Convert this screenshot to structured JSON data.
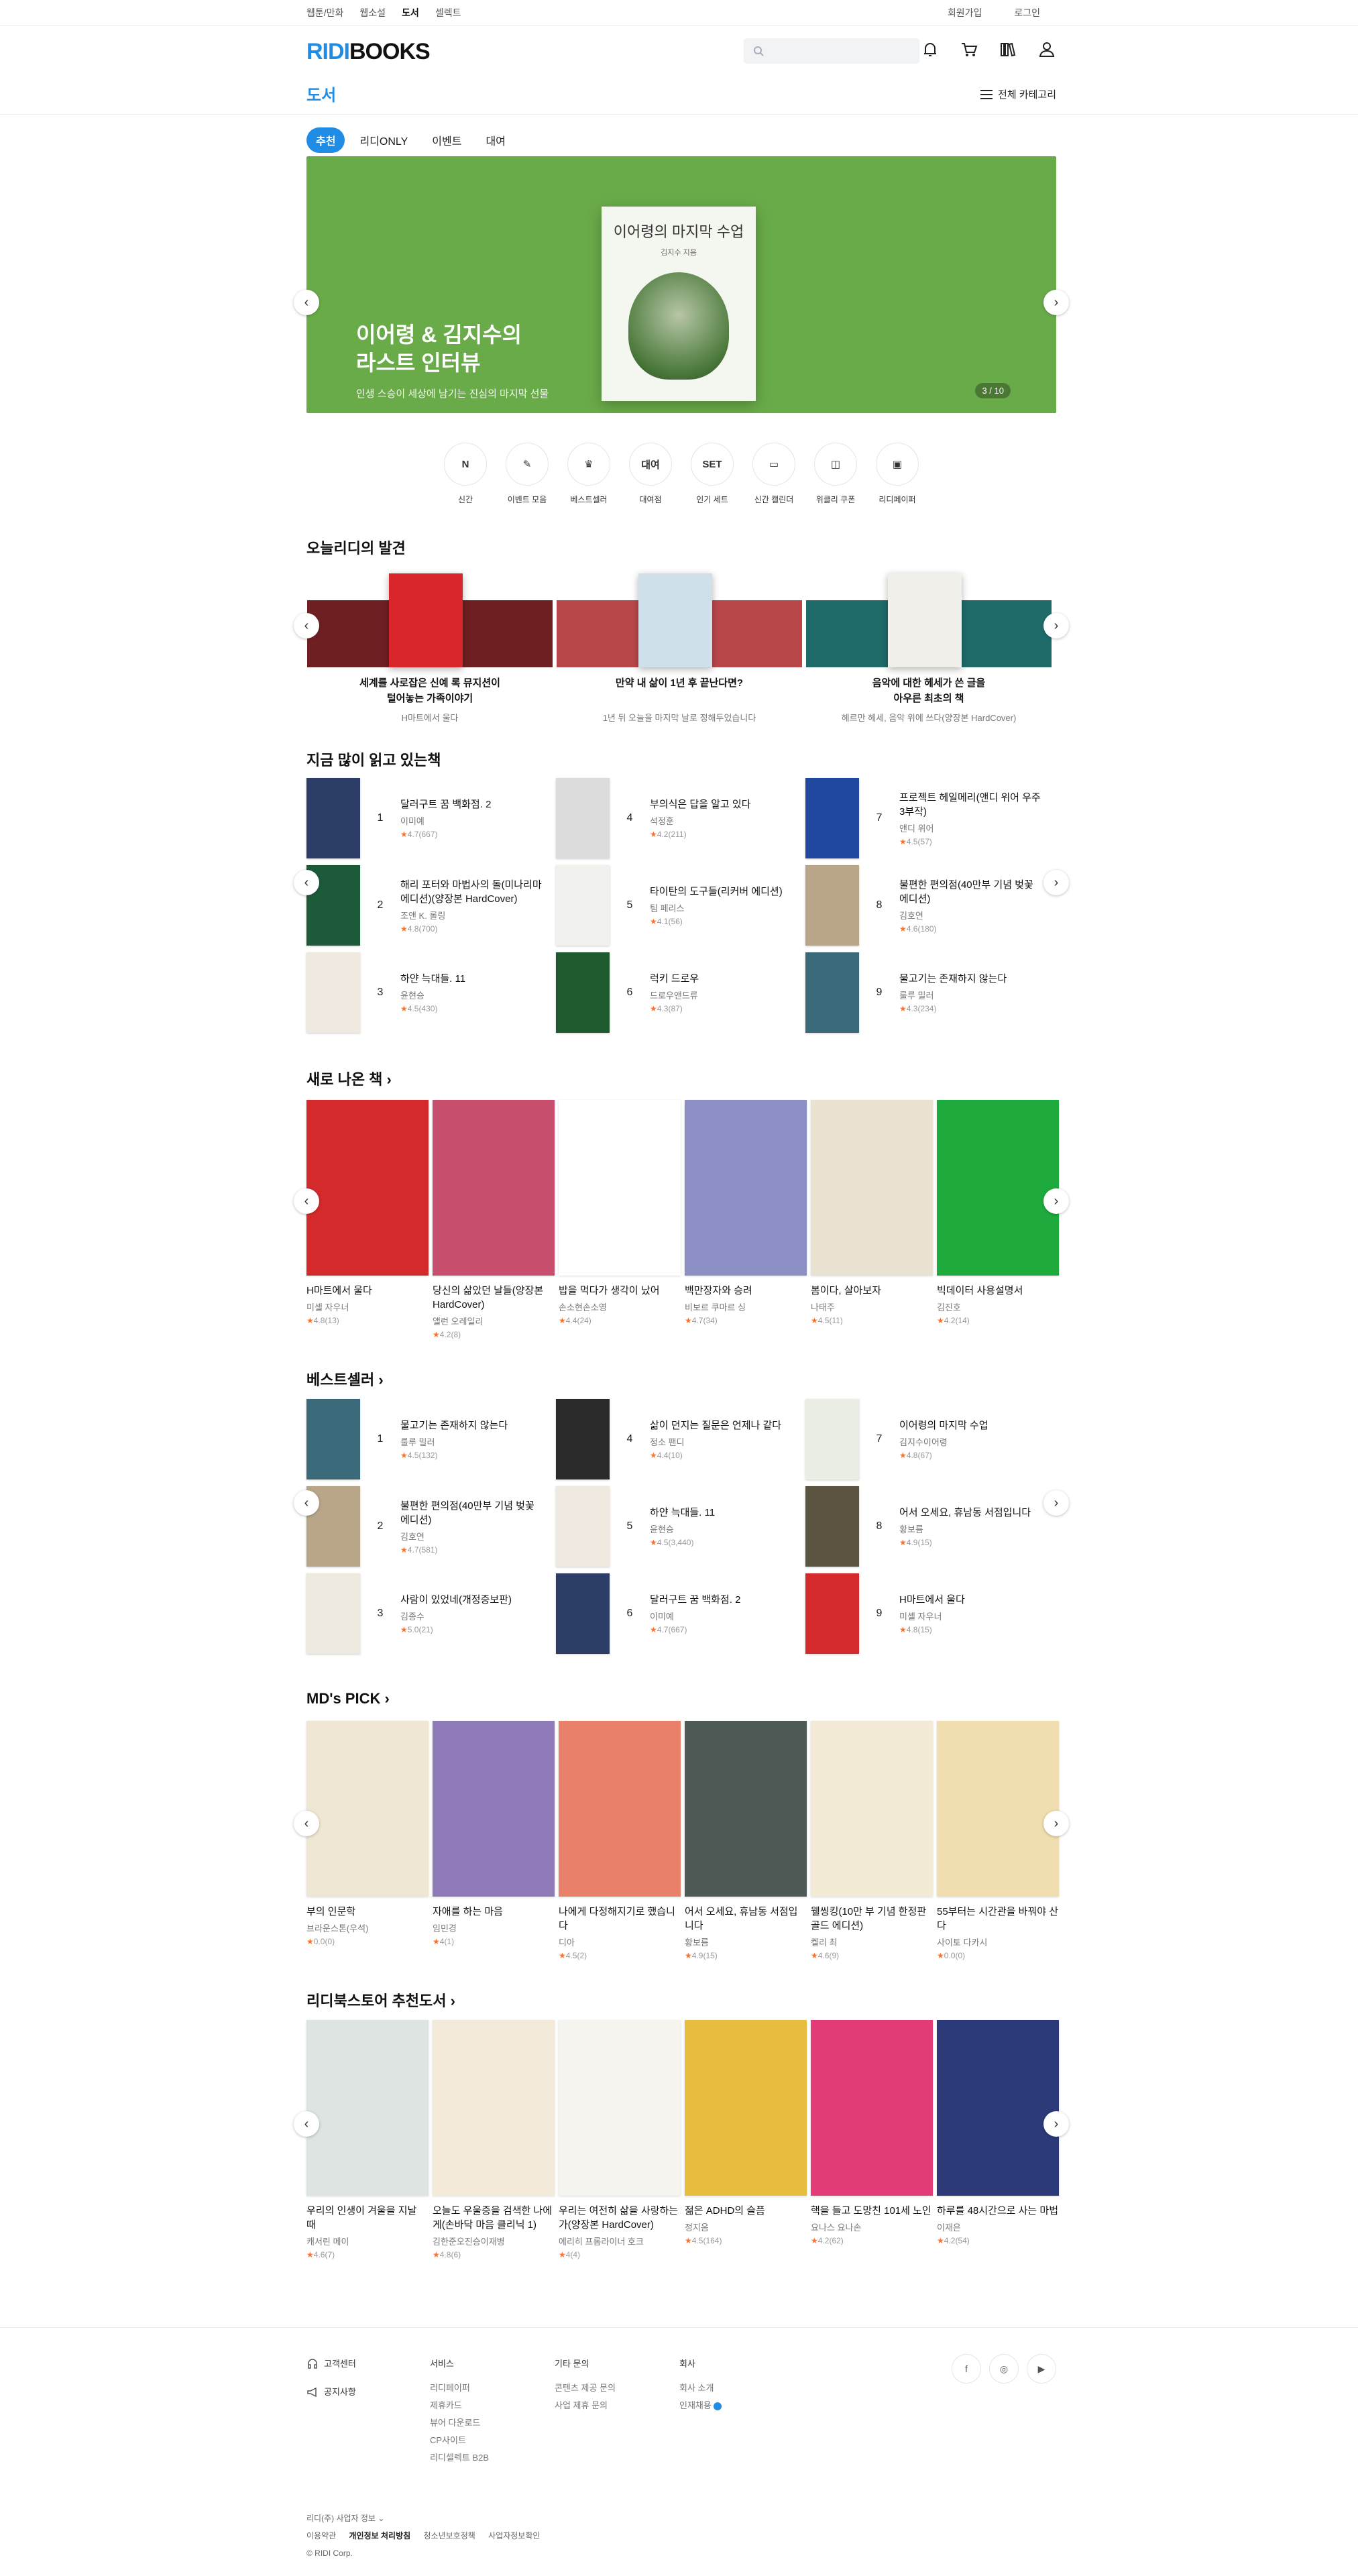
{
  "topnav": {
    "items": [
      "웹툰/만화",
      "웹소설",
      "도서",
      "셀렉트"
    ],
    "right": [
      "회원가입",
      "로그인"
    ]
  },
  "header": {
    "logo_a": "RIDI",
    "logo_b": "BOOKS",
    "search_placeholder": ""
  },
  "category": {
    "title": "도서",
    "all_label": "전체 카테고리"
  },
  "tabs": [
    "추천",
    "리디ONLY",
    "이벤트",
    "대여"
  ],
  "banner": {
    "book_title": "이어령의 마지막 수업",
    "book_author": "김지수 지음",
    "headline1": "이어령 & 김지수의",
    "headline2": "라스트 인터뷰",
    "sub": "인생 스승이 세상에 남기는 진심의 마지막 선물",
    "count": "3 / 10",
    "bg": "#6aab49"
  },
  "quick": [
    {
      "icon": "N",
      "label": "신간"
    },
    {
      "icon": "✎",
      "label": "이벤트 모음"
    },
    {
      "icon": "♛",
      "label": "베스트셀러"
    },
    {
      "icon": "대여",
      "label": "대여점"
    },
    {
      "icon": "SET",
      "label": "인기 세트"
    },
    {
      "icon": "▭",
      "label": "신간 캘린더"
    },
    {
      "icon": "◫",
      "label": "위클리 쿠폰"
    },
    {
      "icon": "▣",
      "label": "리디페이퍼"
    }
  ],
  "discovery": {
    "title": "오늘리디의 발견",
    "cards": [
      {
        "title1": "세계를 사로잡은 신예 록 뮤지션이",
        "title2": "털어놓는 가족이야기",
        "sub": "H마트에서 울다",
        "band": "#6e1f22",
        "cover": "#d8262b"
      },
      {
        "title1": "만약 내 삶이 1년 후 끝난다면?",
        "title2": "",
        "sub": "1년 뒤 오늘을 마지막 날로 정해두었습니다",
        "band": "#b9474a",
        "cover": "#cfe0ea"
      },
      {
        "title1": "음악에 대한 헤세가 쓴 글을",
        "title2": "아우른 최초의 책",
        "sub": "헤르만 헤세, 음악 위에 쓰다(양장본 HardCover)",
        "band": "#1e6b6a",
        "cover": "#f1efea"
      }
    ]
  },
  "popular": {
    "title": "지금 많이 읽고 있는책",
    "items": [
      {
        "n": "1",
        "t": "달러구트 꿈 백화점. 2",
        "a": "이미예",
        "s": "4.7(667)",
        "c": "#2c3e68"
      },
      {
        "n": "4",
        "t": "부의식은 답을 알고 있다",
        "a": "석정훈",
        "s": "4.2(211)",
        "c": "#dcdcdc"
      },
      {
        "n": "7",
        "t": "프로젝트 헤일메리(앤디 위어 우주 3부작)",
        "a": "앤디 위어",
        "s": "4.5(57)",
        "c": "#2148a0"
      },
      {
        "n": "2",
        "t": "해리 포터와 마법사의 돌(미나리마 에디션)(양장본 HardCover)",
        "a": "조앤 K. 롤링",
        "s": "4.8(700)",
        "c": "#1c5a3a"
      },
      {
        "n": "5",
        "t": "타이탄의 도구들(리커버 에디션)",
        "a": "팀 페리스",
        "s": "4.1(56)",
        "c": "#f1f1ee"
      },
      {
        "n": "8",
        "t": "불편한 편의점(40만부 기념 벚꽃 에디션)",
        "a": "김호연",
        "s": "4.6(180)",
        "c": "#b9a689"
      },
      {
        "n": "3",
        "t": "하얀 늑대들. 11",
        "a": "윤현승",
        "s": "4.5(430)",
        "c": "#efe9df"
      },
      {
        "n": "6",
        "t": "럭키 드로우",
        "a": "드로우앤드류",
        "s": "4.3(87)",
        "c": "#1f5a2f"
      },
      {
        "n": "9",
        "t": "물고기는 존재하지 않는다",
        "a": "룰루 밀러",
        "s": "4.3(234)",
        "c": "#3a6a7a"
      }
    ]
  },
  "new_books": {
    "title": "새로 나온 책",
    "items": [
      {
        "t": "H마트에서 울다",
        "a": "미셸 자우너",
        "s": "4.8(13)",
        "c": "#d42a2c"
      },
      {
        "t": "당신의 삶았던 날들(양장본 HardCover)",
        "a": "앨런 오레일리",
        "s": "4.2(8)",
        "c": "#c84f6e"
      },
      {
        "t": "밥을 먹다가 생각이 났어",
        "a": "손소현손소영",
        "s": "4.4(24)",
        "c": "#ffffff"
      },
      {
        "t": "백만장자와 승려",
        "a": "비보르 쿠마르 싱",
        "s": "4.7(34)",
        "c": "#8c8fc4"
      },
      {
        "t": "봄이다, 살아보자",
        "a": "나태주",
        "s": "4.5(11)",
        "c": "#eae2d0"
      },
      {
        "t": "빅데이터 사용설명서",
        "a": "김진호",
        "s": "4.2(14)",
        "c": "#1eaa3c"
      }
    ]
  },
  "bestseller": {
    "title": "베스트셀러",
    "items": [
      {
        "n": "1",
        "t": "물고기는 존재하지 않는다",
        "a": "룰루 밀러",
        "s": "4.5(132)",
        "c": "#3a6a7a"
      },
      {
        "n": "4",
        "t": "삶이 던지는 질문은 언제나 같다",
        "a": "정소 팬디",
        "s": "4.4(10)",
        "c": "#2a2a2a"
      },
      {
        "n": "7",
        "t": "이어령의 마지막 수업",
        "a": "김지수이어령",
        "s": "4.8(67)",
        "c": "#e9ede3"
      },
      {
        "n": "2",
        "t": "불편한 편의점(40만부 기념 벚꽃 에디션)",
        "a": "김호연",
        "s": "4.7(581)",
        "c": "#b9a689"
      },
      {
        "n": "5",
        "t": "하얀 늑대들. 11",
        "a": "윤현승",
        "s": "4.5(3,440)",
        "c": "#efe9df"
      },
      {
        "n": "8",
        "t": "어서 오세요, 휴남동 서점입니다",
        "a": "황보름",
        "s": "4.9(15)",
        "c": "#5a5440"
      },
      {
        "n": "3",
        "t": "사람이 있었네(개정증보판)",
        "a": "김종수",
        "s": "5.0(21)",
        "c": "#eeeae0"
      },
      {
        "n": "6",
        "t": "달러구트 꿈 백화점. 2",
        "a": "이미예",
        "s": "4.7(667)",
        "c": "#2c3e68"
      },
      {
        "n": "9",
        "t": "H마트에서 울다",
        "a": "미셸 자우너",
        "s": "4.8(15)",
        "c": "#d42a2c"
      }
    ]
  },
  "md_pick": {
    "title": "MD's PICK",
    "items": [
      {
        "t": "부의 인문학",
        "a": "브라운스톤(우석)",
        "s": "0.0(0)",
        "c": "#f0e6d4"
      },
      {
        "t": "자애를 하는 마음",
        "a": "임민경",
        "s": "4(1)",
        "c": "#8e7bb8"
      },
      {
        "t": "나에게 다정해지기로 했습니다",
        "a": "디아",
        "s": "4.5(2)",
        "c": "#e8806a"
      },
      {
        "t": "어서 오세요, 휴남동 서점입니다",
        "a": "황보름",
        "s": "4.9(15)",
        "c": "#4d5a55"
      },
      {
        "t": "웰씽킹(10만 부 기념 한정판 골드 에디션)",
        "a": "켈리 최",
        "s": "4.6(9)",
        "c": "#f3ead5"
      },
      {
        "t": "55부터는 시간관을 바꿔야 산다",
        "a": "사이토 다카시",
        "s": "0.0(0)",
        "c": "#f0ddb0"
      }
    ]
  },
  "ridi_pick": {
    "title": "리디북스토어 추천도서",
    "items": [
      {
        "t": "우리의 인생이 겨울을 지날 때",
        "a": "캐서린 메이",
        "s": "4.6(7)",
        "c": "#dde4e2"
      },
      {
        "t": "오늘도 우울증을 검색한 나에게(손바닥 마음 클리닉 1)",
        "a": "김한준오진승이재병",
        "s": "4.8(6)",
        "c": "#f4eada"
      },
      {
        "t": "우리는 여전히 삶을 사랑하는가(양장본 HardCover)",
        "a": "에리히 프롬라이너 호크",
        "s": "4(4)",
        "c": "#f6f4ee"
      },
      {
        "t": "젊은 ADHD의 슬픔",
        "a": "정지음",
        "s": "4.5(164)",
        "c": "#e6bd3e"
      },
      {
        "t": "핵을 들고 도망친 101세 노인",
        "a": "요나스 요나손",
        "s": "4.2(62)",
        "c": "#e33a78"
      },
      {
        "t": "하루를 48시간으로 사는 마법",
        "a": "이재은",
        "s": "4.2(54)",
        "c": "#2c3a7a"
      }
    ]
  },
  "footer": {
    "help": [
      "고객센터",
      "공지사항"
    ],
    "cols": [
      {
        "h": "서비스",
        "items": [
          "리디페이퍼",
          "제휴카드",
          "뷰어 다운로드",
          "CP사이트",
          "리디셀렉트 B2B"
        ]
      },
      {
        "h": "기타 문의",
        "items": [
          "콘텐츠 제공 문의",
          "사업 제휴 문의"
        ]
      },
      {
        "h": "회사",
        "items": [
          "회사 소개",
          "인재채용"
        ]
      }
    ],
    "biz": "리디(주) 사업자 정보 ⌄",
    "links": [
      "이용약관",
      "개인정보 처리방침",
      "청소년보호정책",
      "사업자정보확인"
    ],
    "copy": "© RIDI Corp.",
    "social": [
      "f",
      "◎",
      "▶"
    ]
  }
}
